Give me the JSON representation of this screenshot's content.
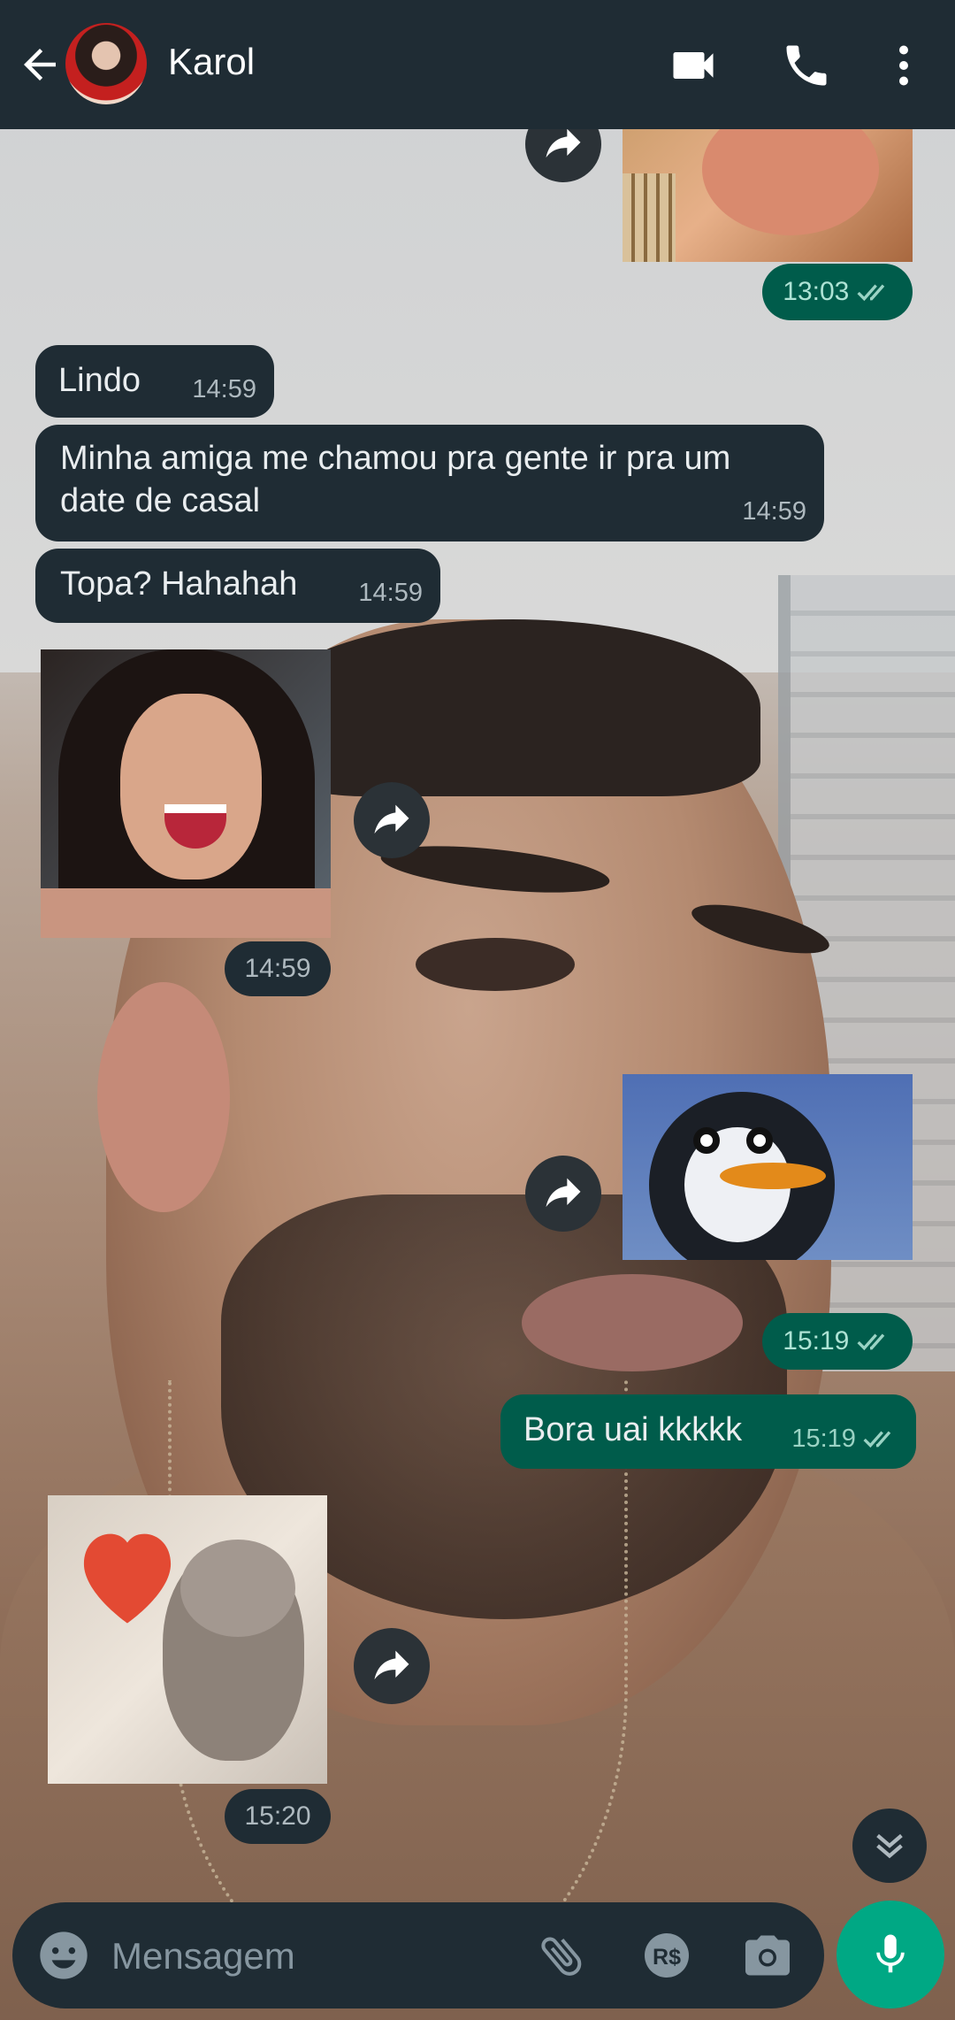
{
  "header": {
    "contact_name": "Karol",
    "icons": [
      "back-arrow-icon",
      "video-call-icon",
      "voice-call-icon",
      "more-options-icon"
    ]
  },
  "messages": [
    {
      "id": "m1",
      "direction": "outgoing",
      "type": "image",
      "description": "forwarded image",
      "time": "13:03",
      "status": "read"
    },
    {
      "id": "m2",
      "direction": "incoming",
      "type": "text",
      "text": "Lindo",
      "time": "14:59"
    },
    {
      "id": "m3",
      "direction": "incoming",
      "type": "text",
      "text": "Minha amiga me chamou pra gente ir pra um date de casal",
      "time": "14:59"
    },
    {
      "id": "m4",
      "direction": "incoming",
      "type": "text",
      "text": "Topa? Hahahah",
      "time": "14:59"
    },
    {
      "id": "m5",
      "direction": "incoming",
      "type": "image",
      "time": "14:59"
    },
    {
      "id": "m6",
      "direction": "outgoing",
      "type": "image",
      "time": "15:19",
      "status": "read"
    },
    {
      "id": "m7",
      "direction": "outgoing",
      "type": "text",
      "text": "Bora uai kkkkk",
      "time": "15:19",
      "status": "read"
    },
    {
      "id": "m8",
      "direction": "incoming",
      "type": "image",
      "time": "15:20"
    }
  ],
  "composer": {
    "placeholder": "Mensagem",
    "icons": [
      "emoji-icon",
      "attach-icon",
      "payment-icon",
      "camera-icon",
      "mic-icon"
    ]
  },
  "colors": {
    "header_bg": "#1f2c34",
    "incoming_bubble": "#1f2c34",
    "outgoing_bubble": "#005c4b",
    "accent": "#00a884",
    "read_ticks": "#53bdeb"
  }
}
